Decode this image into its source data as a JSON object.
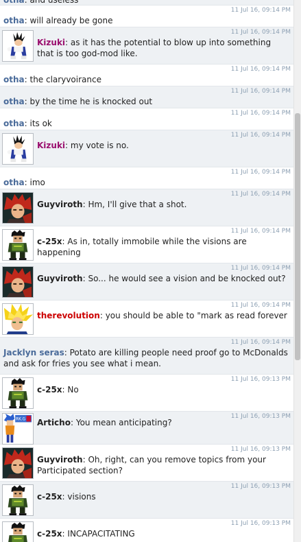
{
  "colors": {
    "otha": "#4a6b9a",
    "kizuki": "#9a0f6e",
    "guyviroth": "#222222",
    "c25x": "#222222",
    "therevolution": "#cc0000",
    "jacklyn": "#4a6b9a",
    "articho": "#222222",
    "timestamp": "#8da0b3"
  },
  "messages": [
    {
      "id": "m0",
      "name": "otha",
      "sep": ": ",
      "text": "and useless",
      "ts": "",
      "avatar": null,
      "nameColor": "#4a6b9a"
    },
    {
      "id": "m1",
      "name": "otha",
      "sep": ": ",
      "text": "will already be gone",
      "ts": "11 Jul 16, 09:14 PM",
      "avatar": null,
      "nameColor": "#4a6b9a"
    },
    {
      "id": "m2",
      "name": "Kizuki",
      "sep": ": ",
      "text": "as it has the potential to blow up into something that is too god-mod like.",
      "ts": "11 Jul 16, 09:14 PM",
      "avatar": "vegeta-avatar",
      "nameColor": "#9a0f6e"
    },
    {
      "id": "m3",
      "name": "otha",
      "sep": ": ",
      "text": "the claryvoirance",
      "ts": "11 Jul 16, 09:14 PM",
      "avatar": null,
      "nameColor": "#4a6b9a"
    },
    {
      "id": "m4",
      "name": "otha",
      "sep": ": ",
      "text": "by the time he is knocked out",
      "ts": "11 Jul 16, 09:14 PM",
      "avatar": null,
      "nameColor": "#4a6b9a"
    },
    {
      "id": "m5",
      "name": "otha",
      "sep": ": ",
      "text": "its ok",
      "ts": "11 Jul 16, 09:14 PM",
      "avatar": null,
      "nameColor": "#4a6b9a"
    },
    {
      "id": "m6",
      "name": "Kizuki",
      "sep": ": ",
      "text": "my vote is no.",
      "ts": "11 Jul 16, 09:14 PM",
      "avatar": "vegeta-avatar",
      "nameColor": "#9a0f6e"
    },
    {
      "id": "m7",
      "name": "otha",
      "sep": ": ",
      "text": "imo",
      "ts": "11 Jul 16, 09:14 PM",
      "avatar": null,
      "nameColor": "#4a6b9a"
    },
    {
      "id": "m8",
      "name": "Guyviroth",
      "sep": ": ",
      "text": "Hm, I'll give that a shot.",
      "ts": "11 Jul 16, 09:14 PM",
      "avatar": "red-hair-avatar",
      "nameColor": "#222222"
    },
    {
      "id": "m9",
      "name": "c-25x",
      "sep": ": ",
      "text": "As in, totally immobile while the visions are happening",
      "ts": "11 Jul 16, 09:14 PM",
      "avatar": "soldier-avatar",
      "nameColor": "#222222"
    },
    {
      "id": "m10",
      "name": "Guyviroth",
      "sep": ": ",
      "text": "So... he would see a vision and be knocked out?",
      "ts": "11 Jul 16, 09:14 PM",
      "avatar": "red-hair-avatar",
      "nameColor": "#222222"
    },
    {
      "id": "m11",
      "name": "therevolution",
      "sep": ": ",
      "text": "you should be able to \"mark as read forever",
      "ts": "11 Jul 16, 09:14 PM",
      "avatar": "super-saiyan-avatar",
      "nameColor": "#cc0000"
    },
    {
      "id": "m12",
      "name": "Jacklyn seras",
      "sep": ": ",
      "text": "Potato are killing people need proof go to McDonalds and ask for fries you see what i mean.",
      "ts": "11 Jul 16, 09:14 PM",
      "avatar": null,
      "nameColor": "#4a6b9a"
    },
    {
      "id": "m13",
      "name": "c-25x",
      "sep": ": ",
      "text": "No",
      "ts": "11 Jul 16, 09:13 PM",
      "avatar": "soldier-avatar",
      "nameColor": "#222222"
    },
    {
      "id": "m14",
      "name": "Articho",
      "sep": ": ",
      "text": "You mean anticipating?",
      "ts": "11 Jul 16, 09:13 PM",
      "avatar": "blue-hair-avatar",
      "nameColor": "#222222"
    },
    {
      "id": "m15",
      "name": "Guyviroth",
      "sep": ": ",
      "text": "Oh, right, can you remove topics from your Participated section?",
      "ts": "11 Jul 16, 09:13 PM",
      "avatar": "red-hair-avatar",
      "nameColor": "#222222"
    },
    {
      "id": "m16",
      "name": "c-25x",
      "sep": ": ",
      "text": "visions",
      "ts": "11 Jul 16, 09:13 PM",
      "avatar": "soldier-avatar",
      "nameColor": "#222222"
    },
    {
      "id": "m17",
      "name": "c-25x",
      "sep": ": ",
      "text": "INCAPACITATING",
      "ts": "11 Jul 16, 09:13 PM",
      "avatar": "soldier-avatar",
      "nameColor": "#222222"
    }
  ]
}
